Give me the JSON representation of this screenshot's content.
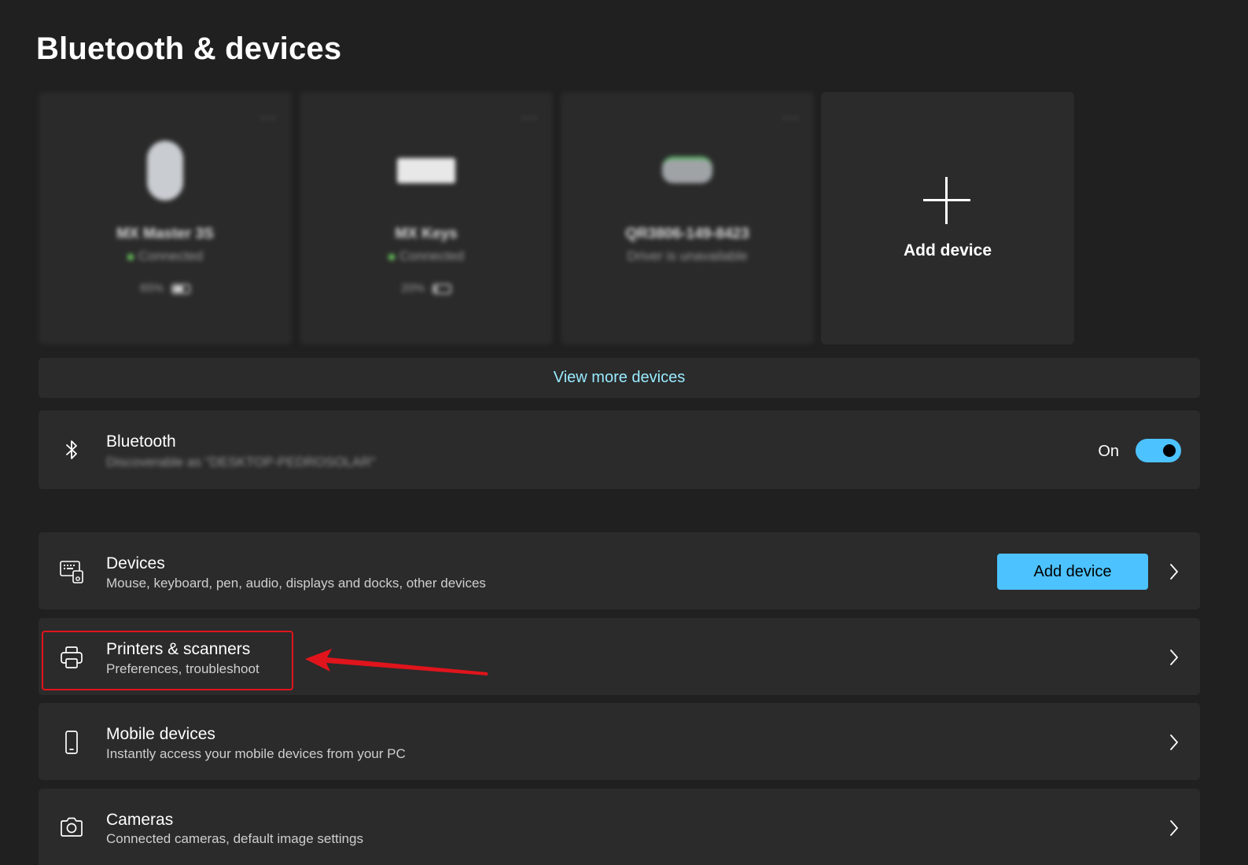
{
  "page": {
    "title": "Bluetooth & devices"
  },
  "device_cards": [
    {
      "name": "MX Master 3S",
      "status": "Connected",
      "battery": "65%",
      "battery_level": 0.65,
      "icon": "mouse-icon"
    },
    {
      "name": "MX Keys",
      "status": "Connected",
      "battery": "20%",
      "battery_level": 0.2,
      "icon": "keyboard-icon"
    },
    {
      "name": "QR3806-149-8423",
      "status": "Driver is unavailable",
      "icon": "dock-icon"
    }
  ],
  "add_card": {
    "label": "Add device",
    "icon": "plus-icon"
  },
  "view_more": {
    "label": "View more devices"
  },
  "bluetooth": {
    "title": "Bluetooth",
    "subtitle": "Discoverable as \"DESKTOP-PEDROSOLAR\"",
    "toggle_label": "On",
    "toggle_on": true,
    "icon": "bluetooth-icon"
  },
  "rows": [
    {
      "title": "Devices",
      "subtitle": "Mouse, keyboard, pen, audio, displays and docks, other devices",
      "button_label": "Add device",
      "icon": "devices-icon"
    },
    {
      "title": "Printers & scanners",
      "subtitle": "Preferences, troubleshoot",
      "icon": "printer-icon"
    },
    {
      "title": "Mobile devices",
      "subtitle": "Instantly access your mobile devices from your PC",
      "icon": "phone-icon"
    },
    {
      "title": "Cameras",
      "subtitle": "Connected cameras, default image settings",
      "icon": "camera-icon"
    }
  ],
  "colors": {
    "background": "#202020",
    "card": "#2b2b2b",
    "accent": "#4cc2ff",
    "link": "#99ebff",
    "annotation": "#e0141c"
  }
}
